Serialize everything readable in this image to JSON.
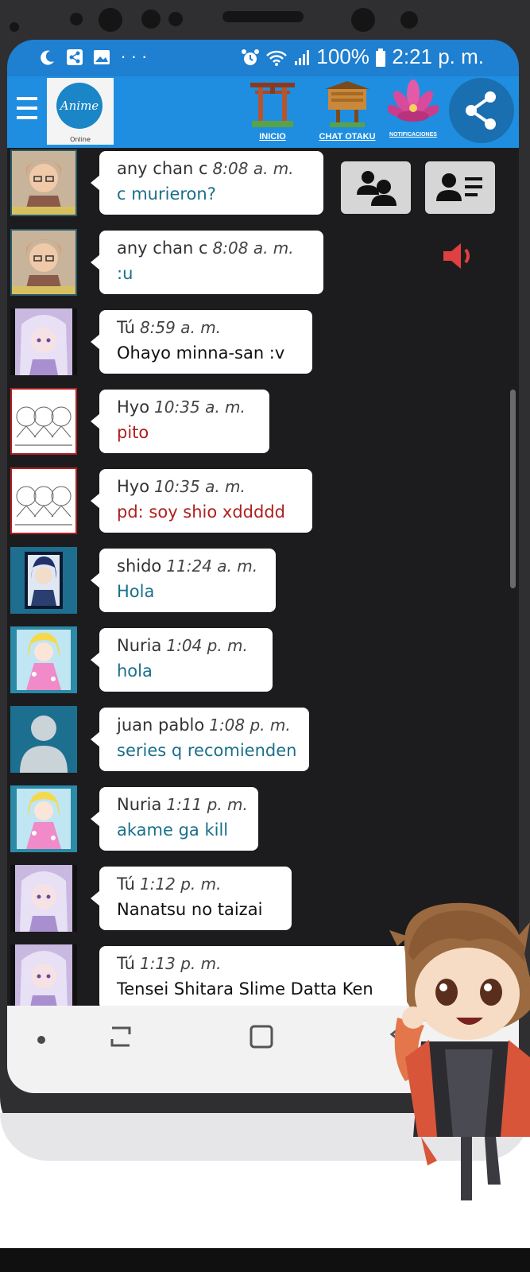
{
  "status_bar": {
    "left_icons": [
      "moon-icon",
      "share-icon",
      "image-icon",
      "more-icon"
    ],
    "battery": "100%",
    "time": "2:21 p. m."
  },
  "app": {
    "logo_text": "Anime",
    "logo_sub": "Online",
    "nav": [
      {
        "label": "INICIO",
        "icon": "torii-gate-icon"
      },
      {
        "label": "CHAT OTAKU",
        "icon": "sign-board-icon"
      },
      {
        "label": "NOTIFICACIONES",
        "icon": "lotus-icon"
      }
    ]
  },
  "chat": {
    "messages": [
      {
        "name": "any chan c",
        "time": "8:08 a. m.",
        "text": "c murieron?",
        "color": "teal",
        "avatar": "girl-glasses"
      },
      {
        "name": "any chan c",
        "time": "8:08 a. m.",
        "text": ":u",
        "color": "teal",
        "avatar": "girl-glasses"
      },
      {
        "name": "Tú",
        "time": "8:59 a. m.",
        "text": "Ohayo minna-san :v",
        "color": "black",
        "avatar": "girl-white-hair"
      },
      {
        "name": "Hyo",
        "time": "10:35 a. m.",
        "text": "pito",
        "color": "red",
        "avatar": "sketch"
      },
      {
        "name": "Hyo",
        "time": "10:35 a. m.",
        "text": "pd: soy shio xddddd",
        "color": "red",
        "avatar": "sketch"
      },
      {
        "name": "shido",
        "time": "11:24 a. m.",
        "text": "Hola",
        "color": "teal",
        "avatar": "boy-blue-hair"
      },
      {
        "name": "Nuria",
        "time": "1:04 p. m.",
        "text": "hola",
        "color": "teal",
        "avatar": "girl-pink-dress"
      },
      {
        "name": "juan pablo",
        "time": "1:08 p. m.",
        "text": "series q recomienden",
        "color": "teal",
        "avatar": "default-user"
      },
      {
        "name": "Nuria",
        "time": "1:11 p. m.",
        "text": "akame ga kill",
        "color": "teal",
        "avatar": "girl-pink-dress"
      },
      {
        "name": "Tú",
        "time": "1:12 p. m.",
        "text": "Nanatsu no taizai",
        "color": "black",
        "avatar": "girl-white-hair"
      },
      {
        "name": "Tú",
        "time": "1:13 p. m.",
        "text": "Tensei Shitara Slime Datta Ken",
        "color": "black",
        "avatar": "girl-white-hair"
      }
    ]
  },
  "colors": {
    "status_bar": "#1f7fd0",
    "app_bar": "#1f8ee0",
    "chat_bg": "#1c1c1e",
    "teal_text": "#1a6f8a",
    "red_text": "#b01f1f",
    "speaker": "#e04040"
  }
}
